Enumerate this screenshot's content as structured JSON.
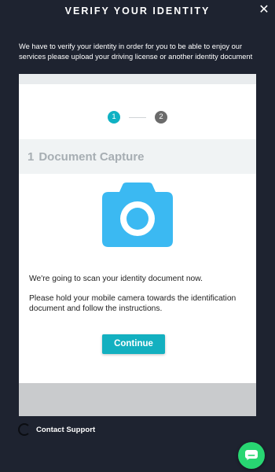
{
  "header": {
    "title": "VERIFY YOUR IDENTITY",
    "close_symbol": "✕"
  },
  "intro_text": "We have to verify your identity in order for you to be able to enjoy our services please upload your driving license or another identity document",
  "stepper": {
    "steps": [
      "1",
      "2"
    ],
    "active_step": 1,
    "active_color": "#0fb1c3",
    "inactive_color": "#6b6b6b"
  },
  "section": {
    "number": "1",
    "title": "Document Capture"
  },
  "camera_icon_color": "#3bb9f2",
  "body": {
    "paragraph_1": "We're going to scan your identity document now.",
    "paragraph_2": "Please hold your mobile camera towards the identification document and follow the instructions."
  },
  "continue_label": "Continue",
  "accent_color": "#13b0c0",
  "support_label": "Contact Support",
  "chat_button_color": "#28d672",
  "icons": [
    "close-icon",
    "camera-icon",
    "support-icon",
    "chat-icon"
  ]
}
